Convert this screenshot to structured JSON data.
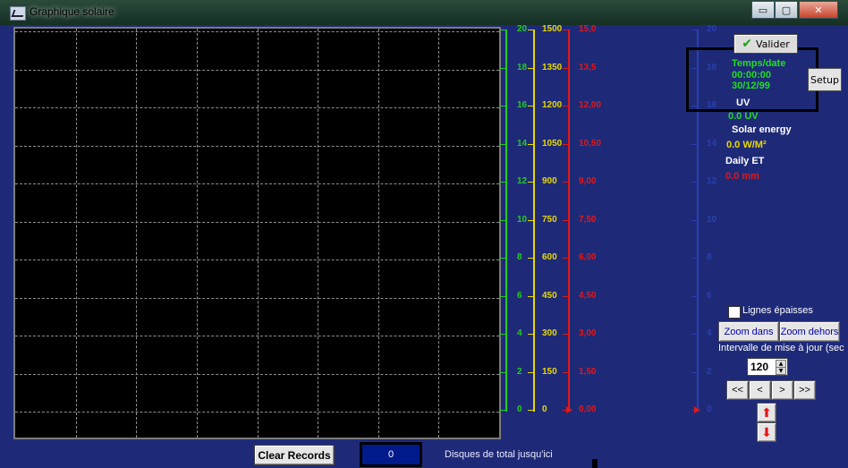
{
  "window": {
    "title": "Graphique solaire",
    "minimize": "▭",
    "maximize": "▢",
    "close": "✕"
  },
  "axes": {
    "green": [
      "20",
      "18",
      "16",
      "14",
      "12",
      "10",
      "8",
      "6",
      "4",
      "2",
      "0"
    ],
    "yellow": [
      "1500",
      "1350",
      "1200",
      "1050",
      "900",
      "750",
      "600",
      "450",
      "300",
      "150",
      "0"
    ],
    "red": [
      "15,0",
      "13,5",
      "12,00",
      "10,50",
      "9,00",
      "7,50",
      "6,00",
      "4,50",
      "3,00",
      "1,50",
      "0,00"
    ],
    "faint": [
      "20",
      "18",
      "16",
      "14",
      "12",
      "10",
      "8",
      "6",
      "4",
      "2",
      "0"
    ]
  },
  "colors": {
    "green": "#22cc22",
    "yellow": "#e8d800",
    "red": "#e01818",
    "faint": "#2a3fb0",
    "plot_bg": "#000000",
    "panel_bg": "#1e2a78"
  },
  "panel": {
    "valider_label": "Valider",
    "valider_icon": "check-icon",
    "setup_label": "Setup",
    "time_label": "Temps/date",
    "time_value": "00:00:00",
    "date_value": "30/12/99",
    "uv_label": "UV",
    "uv_value": "0.0 UV",
    "solar_label": "Solar energy",
    "solar_value": "0.0 W/M²",
    "et_label": "Daily ET",
    "et_value": "0.0 mm",
    "thick_lines_label": "Lignes épaisses",
    "zoom_in_label": "Zoom dans",
    "zoom_out_label": "Zoom dehors",
    "interval_label": "Intervalle de mise à jour (sec",
    "interval_value": "120",
    "nav_first": "<<",
    "nav_prev": "<",
    "nav_next": ">",
    "nav_last": ">>"
  },
  "footer": {
    "clear_label": "Clear Records",
    "count_value": "0",
    "count_label": "Disques de total jusqu'ici"
  }
}
